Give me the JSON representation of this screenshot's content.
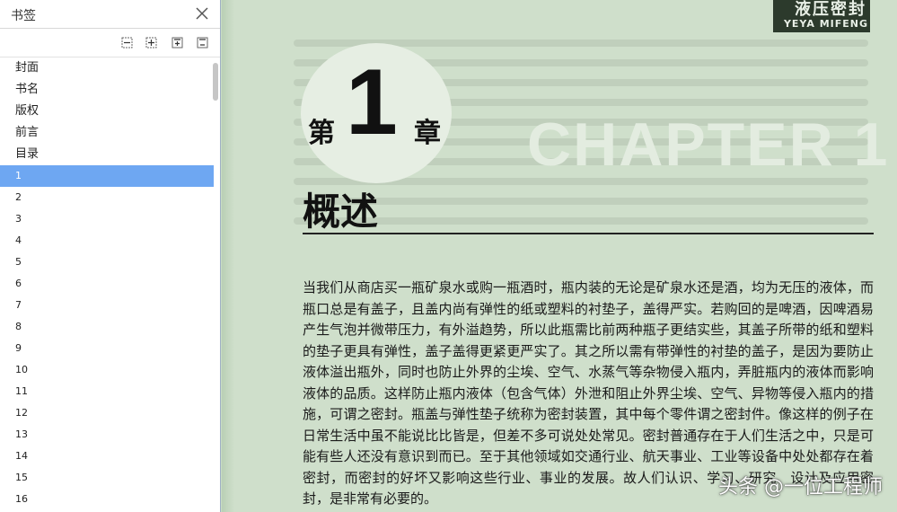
{
  "sidebar": {
    "title": "书签",
    "items": [
      "封面",
      "书名",
      "版权",
      "前言",
      "目录",
      "1",
      "2",
      "3",
      "4",
      "5",
      "6",
      "7",
      "8",
      "9",
      "10",
      "11",
      "12",
      "13",
      "14",
      "15",
      "16"
    ],
    "selected_index": 5
  },
  "page": {
    "logo_cn": "液压密封",
    "logo_en": "YEYA MIFENG",
    "chapter_prefix": "第",
    "chapter_number": "1",
    "chapter_suffix": "章",
    "chapter_en": "CHAPTER 1",
    "chapter_title": "概述",
    "body": "当我们从商店买一瓶矿泉水或购一瓶酒时，瓶内装的无论是矿泉水还是酒，均为无压的液体，而瓶口总是有盖子，且盖内尚有弹性的纸或塑料的衬垫子，盖得严实。若购回的是啤酒，因啤酒易产生气泡并微带压力，有外溢趋势，所以此瓶需比前两种瓶子更结实些，其盖子所带的纸和塑料的垫子更具有弹性，盖子盖得更紧更严实了。其之所以需有带弹性的衬垫的盖子，是因为要防止液体溢出瓶外，同时也防止外界的尘埃、空气、水蒸气等杂物侵入瓶内，弄脏瓶内的液体而影响液体的品质。这样防止瓶内液体（包含气体）外泄和阻止外界尘埃、空气、异物等侵入瓶内的措施，可谓之密封。瓶盖与弹性垫子统称为密封装置，其中每个零件谓之密封件。像这样的例子在日常生活中虽不能说比比皆是，但差不多可说处处常见。密封普通存在于人们生活之中，只是可能有些人还没有意识到而已。至于其他领域如交通行业、航天事业、工业等设备中处处都存在着密封，而密封的好坏又影响这些行业、事业的发展。故人们认识、学习、研究、设计及应用密封，是非常有必要的。",
    "watermark": "头条 @一位工程师"
  }
}
